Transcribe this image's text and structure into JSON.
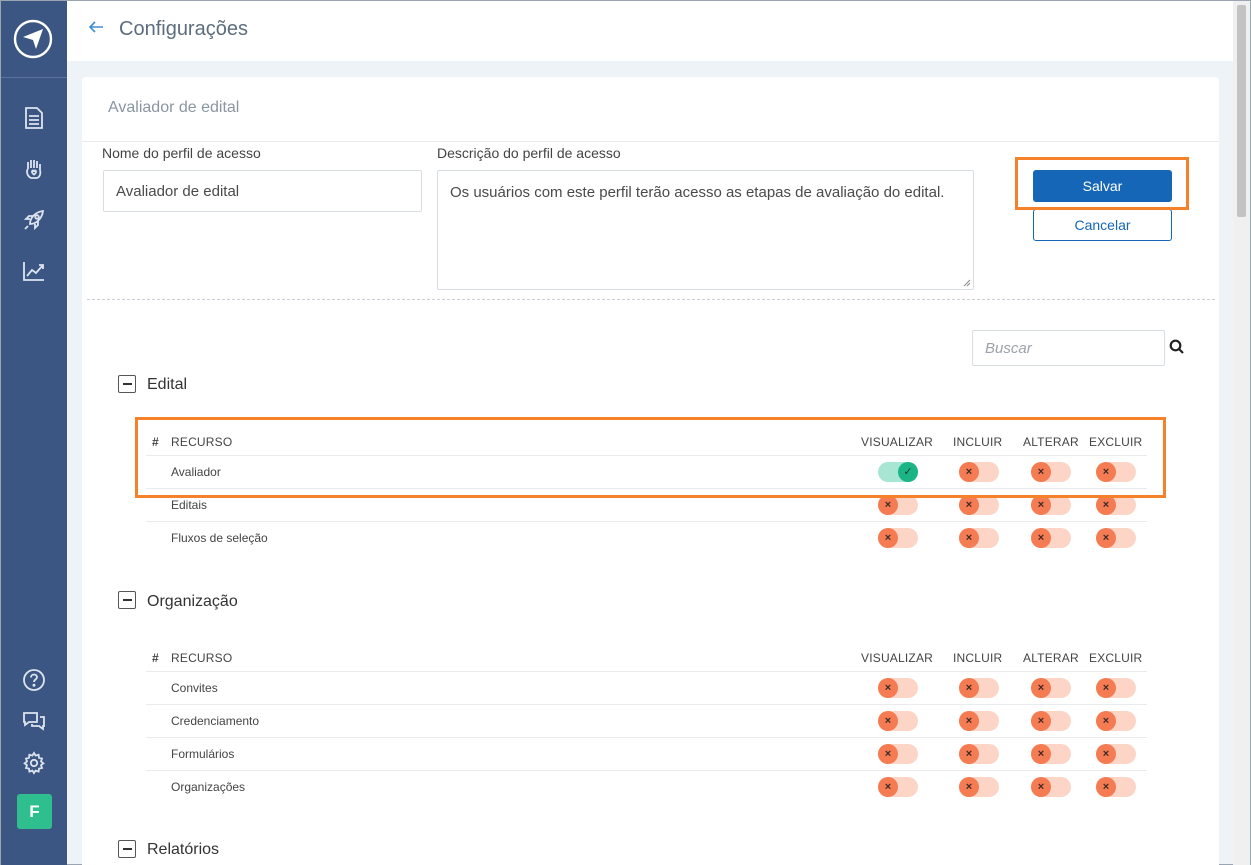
{
  "header": {
    "title": "Configurações"
  },
  "card": {
    "title": "Avaliador de edital",
    "name_label": "Nome do perfil de acesso",
    "name_value": "Avaliador de edital",
    "desc_label": "Descrição do perfil de acesso",
    "desc_value": "Os usuários com este perfil terão acesso as etapas de avaliação do edital.",
    "save_label": "Salvar",
    "cancel_label": "Cancelar",
    "search_placeholder": "Buscar"
  },
  "sidebar": {
    "icons": [
      "logo-icon",
      "document-icon",
      "hand-heart-icon",
      "rocket-icon",
      "chart-line-icon",
      "help-icon",
      "chat-icon",
      "gear-icon"
    ],
    "avatar": "F"
  },
  "table_headers": {
    "hash": "#",
    "resource": "RECURSO",
    "view": "VISUALIZAR",
    "include": "INCLUIR",
    "alter": "ALTERAR",
    "delete": "EXCLUIR"
  },
  "sections": [
    {
      "title": "Edital",
      "rows": [
        {
          "label": "Avaliador",
          "perms": [
            true,
            false,
            false,
            false
          ]
        },
        {
          "label": "Editais",
          "perms": [
            false,
            false,
            false,
            false
          ]
        },
        {
          "label": "Fluxos de seleção",
          "perms": [
            false,
            false,
            false,
            false
          ]
        }
      ]
    },
    {
      "title": "Organização",
      "rows": [
        {
          "label": "Convites",
          "perms": [
            false,
            false,
            false,
            false
          ]
        },
        {
          "label": "Credenciamento",
          "perms": [
            false,
            false,
            false,
            false
          ]
        },
        {
          "label": "Formulários",
          "perms": [
            false,
            false,
            false,
            false
          ]
        },
        {
          "label": "Organizações",
          "perms": [
            false,
            false,
            false,
            false
          ]
        }
      ]
    },
    {
      "title": "Relatórios",
      "rows": []
    }
  ],
  "colors": {
    "sidebar": "#3b5682",
    "primary": "#1566b7",
    "highlight": "#f5822a",
    "toggle_off": "#f47b52",
    "toggle_on": "#1bb585"
  }
}
